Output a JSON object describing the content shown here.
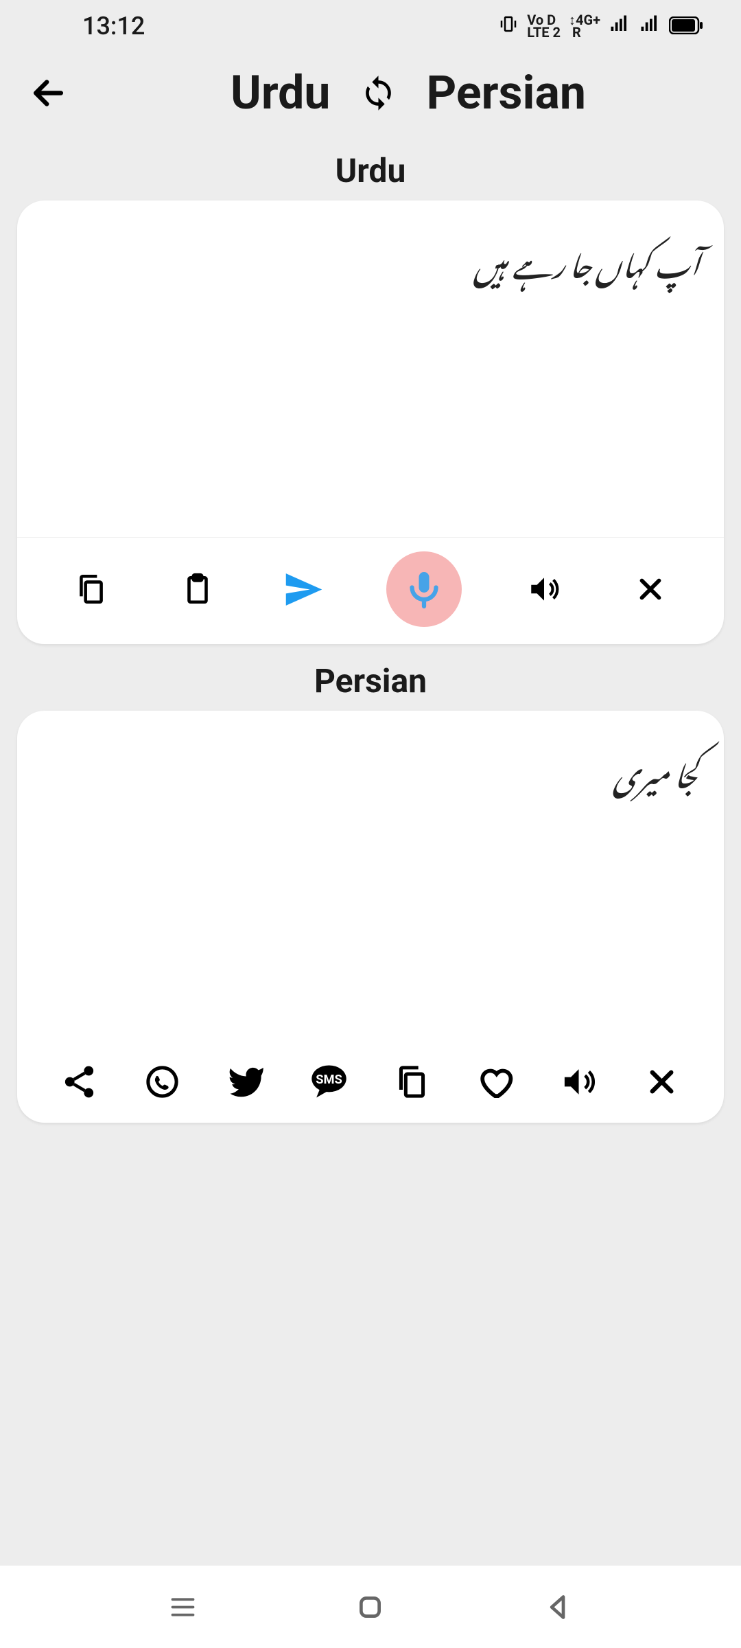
{
  "status": {
    "time": "13:12",
    "icons": [
      "vibrate",
      "VoLTE",
      "4G+",
      "signal-1",
      "signal-2",
      "battery"
    ]
  },
  "header": {
    "source_lang": "Urdu",
    "target_lang": "Persian"
  },
  "source": {
    "label": "Urdu",
    "text": "آپ کہاں جا رہے ہیں"
  },
  "target": {
    "label": "Persian",
    "text": "کجا میری"
  },
  "source_toolbar": {
    "icons": [
      "copy",
      "paste",
      "send",
      "mic",
      "speaker",
      "clear"
    ]
  },
  "target_toolbar": {
    "icons": [
      "share",
      "whatsapp",
      "twitter",
      "sms",
      "copy",
      "favorite",
      "speaker",
      "clear"
    ]
  },
  "colors": {
    "bg": "#ededed",
    "card": "#ffffff",
    "accent_blue": "#1e9bf0",
    "mic_bg": "#f7b6b6",
    "mic_fg": "#46a3e8"
  }
}
